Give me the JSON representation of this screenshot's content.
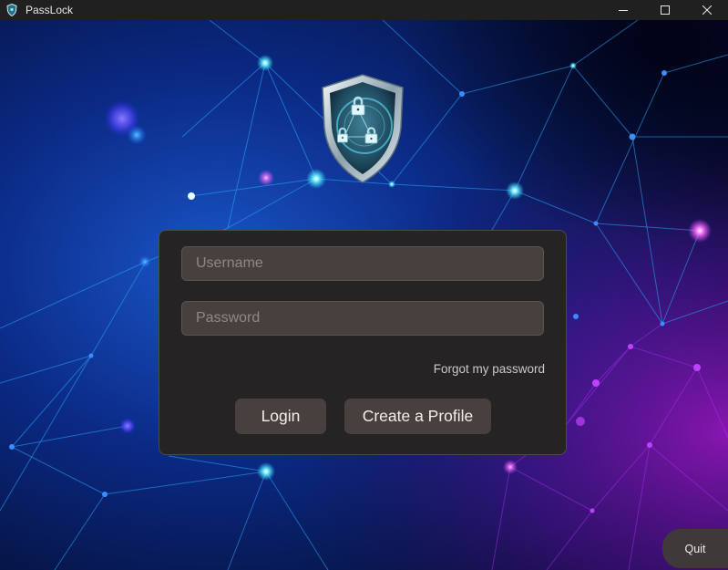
{
  "window": {
    "title": "PassLock",
    "app_icon": "shield-icon",
    "controls": [
      "minimize-icon",
      "maximize-icon",
      "close-icon"
    ]
  },
  "login_form": {
    "username_placeholder": "Username",
    "password_placeholder": "Password",
    "forgot_link": "Forgot my password",
    "login_button": "Login",
    "create_profile_button": "Create a Profile"
  },
  "quit_button": "Quit",
  "logo": "shield-lock-icon",
  "colors": {
    "card_bg": "#262324",
    "input_bg": "#48403f",
    "accent_cyan": "#22e6ff",
    "accent_magenta": "#e040ff",
    "background_blue": "#0a2a8a"
  }
}
